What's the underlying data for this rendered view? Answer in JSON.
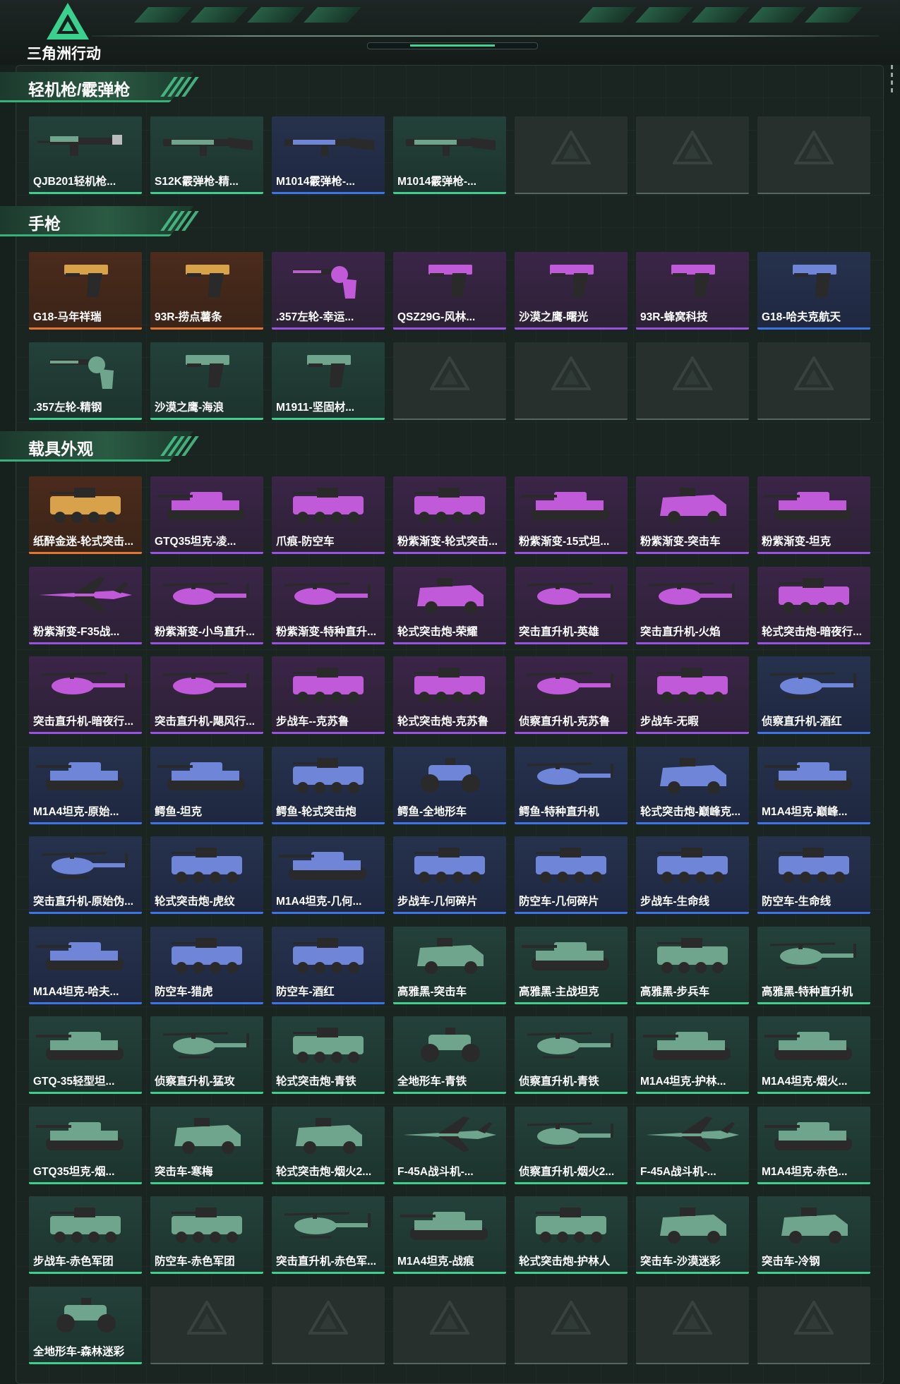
{
  "header": {
    "logo_text": "三角洲行动"
  },
  "colors": {
    "accent": "#3fcf8c",
    "gold": "#e5762f",
    "purple": "#9a52e0",
    "blue": "#3d74e6",
    "green": "#3fcf8c"
  },
  "sections": [
    {
      "title": "轻机枪/霰弹枪",
      "items": [
        {
          "label": "QJB201轻机枪...",
          "rarity": "green",
          "icon": "lmg"
        },
        {
          "label": "S12K霰弹枪-精...",
          "rarity": "green",
          "icon": "shotgun"
        },
        {
          "label": "M1014霰弹枪-...",
          "rarity": "blue",
          "icon": "shotgun"
        },
        {
          "label": "M1014霰弹枪-...",
          "rarity": "green",
          "icon": "shotgun"
        },
        {
          "label": "",
          "rarity": "empty",
          "icon": ""
        },
        {
          "label": "",
          "rarity": "empty",
          "icon": ""
        },
        {
          "label": "",
          "rarity": "empty",
          "icon": ""
        }
      ]
    },
    {
      "title": "手枪",
      "items": [
        {
          "label": "G18-马年祥瑞",
          "rarity": "gold",
          "icon": "pistol"
        },
        {
          "label": "93R-捞点薯条",
          "rarity": "gold",
          "icon": "pistol"
        },
        {
          "label": ".357左轮-幸运...",
          "rarity": "purple",
          "icon": "revolver"
        },
        {
          "label": "QSZ29G-风林...",
          "rarity": "purple",
          "icon": "pistol"
        },
        {
          "label": "沙漠之鹰-曙光",
          "rarity": "purple",
          "icon": "pistol"
        },
        {
          "label": "93R-蜂窝科技",
          "rarity": "purple",
          "icon": "pistol"
        },
        {
          "label": "G18-哈夫克航天",
          "rarity": "blue",
          "icon": "pistol"
        },
        {
          "label": ".357左轮-精钢",
          "rarity": "green",
          "icon": "revolver"
        },
        {
          "label": "沙漠之鹰-海浪",
          "rarity": "green",
          "icon": "pistol"
        },
        {
          "label": "M1911-坚固材...",
          "rarity": "green",
          "icon": "pistol"
        },
        {
          "label": "",
          "rarity": "empty",
          "icon": ""
        },
        {
          "label": "",
          "rarity": "empty",
          "icon": ""
        },
        {
          "label": "",
          "rarity": "empty",
          "icon": ""
        },
        {
          "label": "",
          "rarity": "empty",
          "icon": ""
        }
      ]
    },
    {
      "title": "载具外观",
      "items": [
        {
          "label": "纸醉金迷-轮式突击...",
          "rarity": "gold",
          "icon": "apc"
        },
        {
          "label": "GTQ35坦克-凌...",
          "rarity": "purple",
          "icon": "tank"
        },
        {
          "label": "爪痕-防空车",
          "rarity": "purple",
          "icon": "apc"
        },
        {
          "label": "粉紫渐变-轮式突击...",
          "rarity": "purple",
          "icon": "apc"
        },
        {
          "label": "粉紫渐变-15式坦...",
          "rarity": "purple",
          "icon": "tank"
        },
        {
          "label": "粉紫渐变-突击车",
          "rarity": "purple",
          "icon": "car"
        },
        {
          "label": "粉紫渐变-坦克",
          "rarity": "purple",
          "icon": "tank"
        },
        {
          "label": "粉紫渐变-F35战...",
          "rarity": "purple",
          "icon": "jet"
        },
        {
          "label": "粉紫渐变-小鸟直升...",
          "rarity": "purple",
          "icon": "heli"
        },
        {
          "label": "粉紫渐变-特种直升...",
          "rarity": "purple",
          "icon": "heli"
        },
        {
          "label": "轮式突击炮-荣耀",
          "rarity": "purple",
          "icon": "car"
        },
        {
          "label": "突击直升机-英雄",
          "rarity": "purple",
          "icon": "heli"
        },
        {
          "label": "突击直升机-火焰",
          "rarity": "purple",
          "icon": "heli"
        },
        {
          "label": "轮式突击炮-暗夜行...",
          "rarity": "purple",
          "icon": "apc"
        },
        {
          "label": "突击直升机-暗夜行...",
          "rarity": "purple",
          "icon": "heli"
        },
        {
          "label": "突击直升机-飓风行...",
          "rarity": "purple",
          "icon": "heli"
        },
        {
          "label": "步战车--克苏鲁",
          "rarity": "purple",
          "icon": "apc"
        },
        {
          "label": "轮式突击炮-克苏鲁",
          "rarity": "purple",
          "icon": "apc"
        },
        {
          "label": "侦察直升机-克苏鲁",
          "rarity": "purple",
          "icon": "heli"
        },
        {
          "label": "步战车-无暇",
          "rarity": "purple",
          "icon": "apc"
        },
        {
          "label": "侦察直升机-酒红",
          "rarity": "blue",
          "icon": "heli"
        },
        {
          "label": "M1A4坦克-原始...",
          "rarity": "blue",
          "icon": "tank"
        },
        {
          "label": "鳄鱼-坦克",
          "rarity": "blue",
          "icon": "tank"
        },
        {
          "label": "鳄鱼-轮式突击炮",
          "rarity": "blue",
          "icon": "apc"
        },
        {
          "label": "鳄鱼-全地形车",
          "rarity": "blue",
          "icon": "atv"
        },
        {
          "label": "鳄鱼-特种直升机",
          "rarity": "blue",
          "icon": "heli"
        },
        {
          "label": "轮式突击炮-巅峰克...",
          "rarity": "blue",
          "icon": "car"
        },
        {
          "label": "M1A4坦克-巅峰...",
          "rarity": "blue",
          "icon": "tank"
        },
        {
          "label": "突击直升机-原始伪...",
          "rarity": "blue",
          "icon": "heli"
        },
        {
          "label": "轮式突击炮-虎纹",
          "rarity": "blue",
          "icon": "apc"
        },
        {
          "label": "M1A4坦克-几何...",
          "rarity": "blue",
          "icon": "tank"
        },
        {
          "label": "步战车-几何碎片",
          "rarity": "blue",
          "icon": "apc"
        },
        {
          "label": "防空车-几何碎片",
          "rarity": "blue",
          "icon": "apc"
        },
        {
          "label": "步战车-生命线",
          "rarity": "blue",
          "icon": "apc"
        },
        {
          "label": "防空车-生命线",
          "rarity": "blue",
          "icon": "apc"
        },
        {
          "label": "M1A4坦克-哈夫...",
          "rarity": "blue",
          "icon": "tank"
        },
        {
          "label": "防空车-猎虎",
          "rarity": "blue",
          "icon": "apc"
        },
        {
          "label": "防空车-酒红",
          "rarity": "blue",
          "icon": "apc"
        },
        {
          "label": "高雅黑-突击车",
          "rarity": "green",
          "icon": "car"
        },
        {
          "label": "高雅黑-主战坦克",
          "rarity": "green",
          "icon": "tank"
        },
        {
          "label": "高雅黑-步兵车",
          "rarity": "green",
          "icon": "apc"
        },
        {
          "label": "高雅黑-特种直升机",
          "rarity": "green",
          "icon": "heli"
        },
        {
          "label": "GTQ-35轻型坦...",
          "rarity": "green",
          "icon": "tank"
        },
        {
          "label": "侦察直升机-猛攻",
          "rarity": "green",
          "icon": "heli"
        },
        {
          "label": "轮式突击炮-青铁",
          "rarity": "green",
          "icon": "apc"
        },
        {
          "label": "全地形车-青铁",
          "rarity": "green",
          "icon": "atv"
        },
        {
          "label": "侦察直升机-青铁",
          "rarity": "green",
          "icon": "heli"
        },
        {
          "label": "M1A4坦克-护林...",
          "rarity": "green",
          "icon": "tank"
        },
        {
          "label": "M1A4坦克-烟火...",
          "rarity": "green",
          "icon": "tank"
        },
        {
          "label": "GTQ35坦克-烟...",
          "rarity": "green",
          "icon": "tank"
        },
        {
          "label": "突击车-寒梅",
          "rarity": "green",
          "icon": "car"
        },
        {
          "label": "轮式突击炮-烟火2...",
          "rarity": "green",
          "icon": "car"
        },
        {
          "label": "F-45A战斗机-...",
          "rarity": "green",
          "icon": "jet"
        },
        {
          "label": "侦察直升机-烟火2...",
          "rarity": "green",
          "icon": "heli"
        },
        {
          "label": "F-45A战斗机-...",
          "rarity": "green",
          "icon": "jet"
        },
        {
          "label": "M1A4坦克-赤色...",
          "rarity": "green",
          "icon": "tank"
        },
        {
          "label": "步战车-赤色军团",
          "rarity": "green",
          "icon": "apc"
        },
        {
          "label": "防空车-赤色军团",
          "rarity": "green",
          "icon": "apc"
        },
        {
          "label": "突击直升机-赤色军...",
          "rarity": "green",
          "icon": "heli"
        },
        {
          "label": "M1A4坦克-战痕",
          "rarity": "green",
          "icon": "tank"
        },
        {
          "label": "轮式突击炮-护林人",
          "rarity": "green",
          "icon": "apc"
        },
        {
          "label": "突击车-沙漠迷彩",
          "rarity": "green",
          "icon": "car"
        },
        {
          "label": "突击车-冷钢",
          "rarity": "green",
          "icon": "car"
        },
        {
          "label": "全地形车-森林迷彩",
          "rarity": "green",
          "icon": "atv"
        },
        {
          "label": "",
          "rarity": "empty",
          "icon": ""
        },
        {
          "label": "",
          "rarity": "empty",
          "icon": ""
        },
        {
          "label": "",
          "rarity": "empty",
          "icon": ""
        },
        {
          "label": "",
          "rarity": "empty",
          "icon": ""
        },
        {
          "label": "",
          "rarity": "empty",
          "icon": ""
        },
        {
          "label": "",
          "rarity": "empty",
          "icon": ""
        }
      ]
    }
  ]
}
